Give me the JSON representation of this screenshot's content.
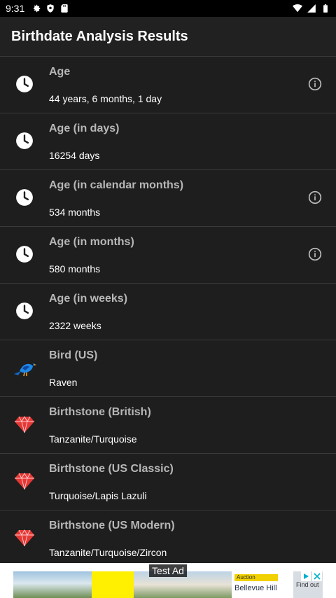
{
  "status_bar": {
    "time": "9:31",
    "left_icons": [
      "gear-icon",
      "shield-icon",
      "sd-card-icon"
    ],
    "right_icons": [
      "wifi-icon",
      "signal-icon",
      "battery-icon"
    ]
  },
  "app_bar": {
    "title": "Birthdate Analysis Results"
  },
  "results": [
    {
      "icon": "clock-icon",
      "title": "Age",
      "value": "44 years, 6 months, 1 day",
      "info": true
    },
    {
      "icon": "clock-icon",
      "title": "Age (in days)",
      "value": "16254 days",
      "info": false
    },
    {
      "icon": "clock-icon",
      "title": "Age (in calendar months)",
      "value": "534 months",
      "info": true
    },
    {
      "icon": "clock-icon",
      "title": "Age (in months)",
      "value": "580 months",
      "info": true
    },
    {
      "icon": "clock-icon",
      "title": "Age (in weeks)",
      "value": "2322 weeks",
      "info": false
    },
    {
      "icon": "bird-icon",
      "title": "Bird (US)",
      "value": "Raven",
      "info": false
    },
    {
      "icon": "gem-icon",
      "title": "Birthstone (British)",
      "value": "Tanzanite/Turquoise",
      "info": false
    },
    {
      "icon": "gem-icon",
      "title": "Birthstone (US Classic)",
      "value": "Turquoise/Lapis Lazuli",
      "info": false
    },
    {
      "icon": "gem-icon",
      "title": "Birthstone (US Modern)",
      "value": "Tanzanite/Turquoise/Zircon",
      "info": false
    }
  ],
  "ad": {
    "label": "Test Ad",
    "card_tag": "Auction",
    "card_title": "Bellevue Hill",
    "side_text": "Find out"
  },
  "colors": {
    "background": "#1e1e1e",
    "app_bar": "#212121",
    "title_gray": "#b7b7b7",
    "gem_red": "#e53935",
    "bird_blue": "#1e88e5"
  }
}
